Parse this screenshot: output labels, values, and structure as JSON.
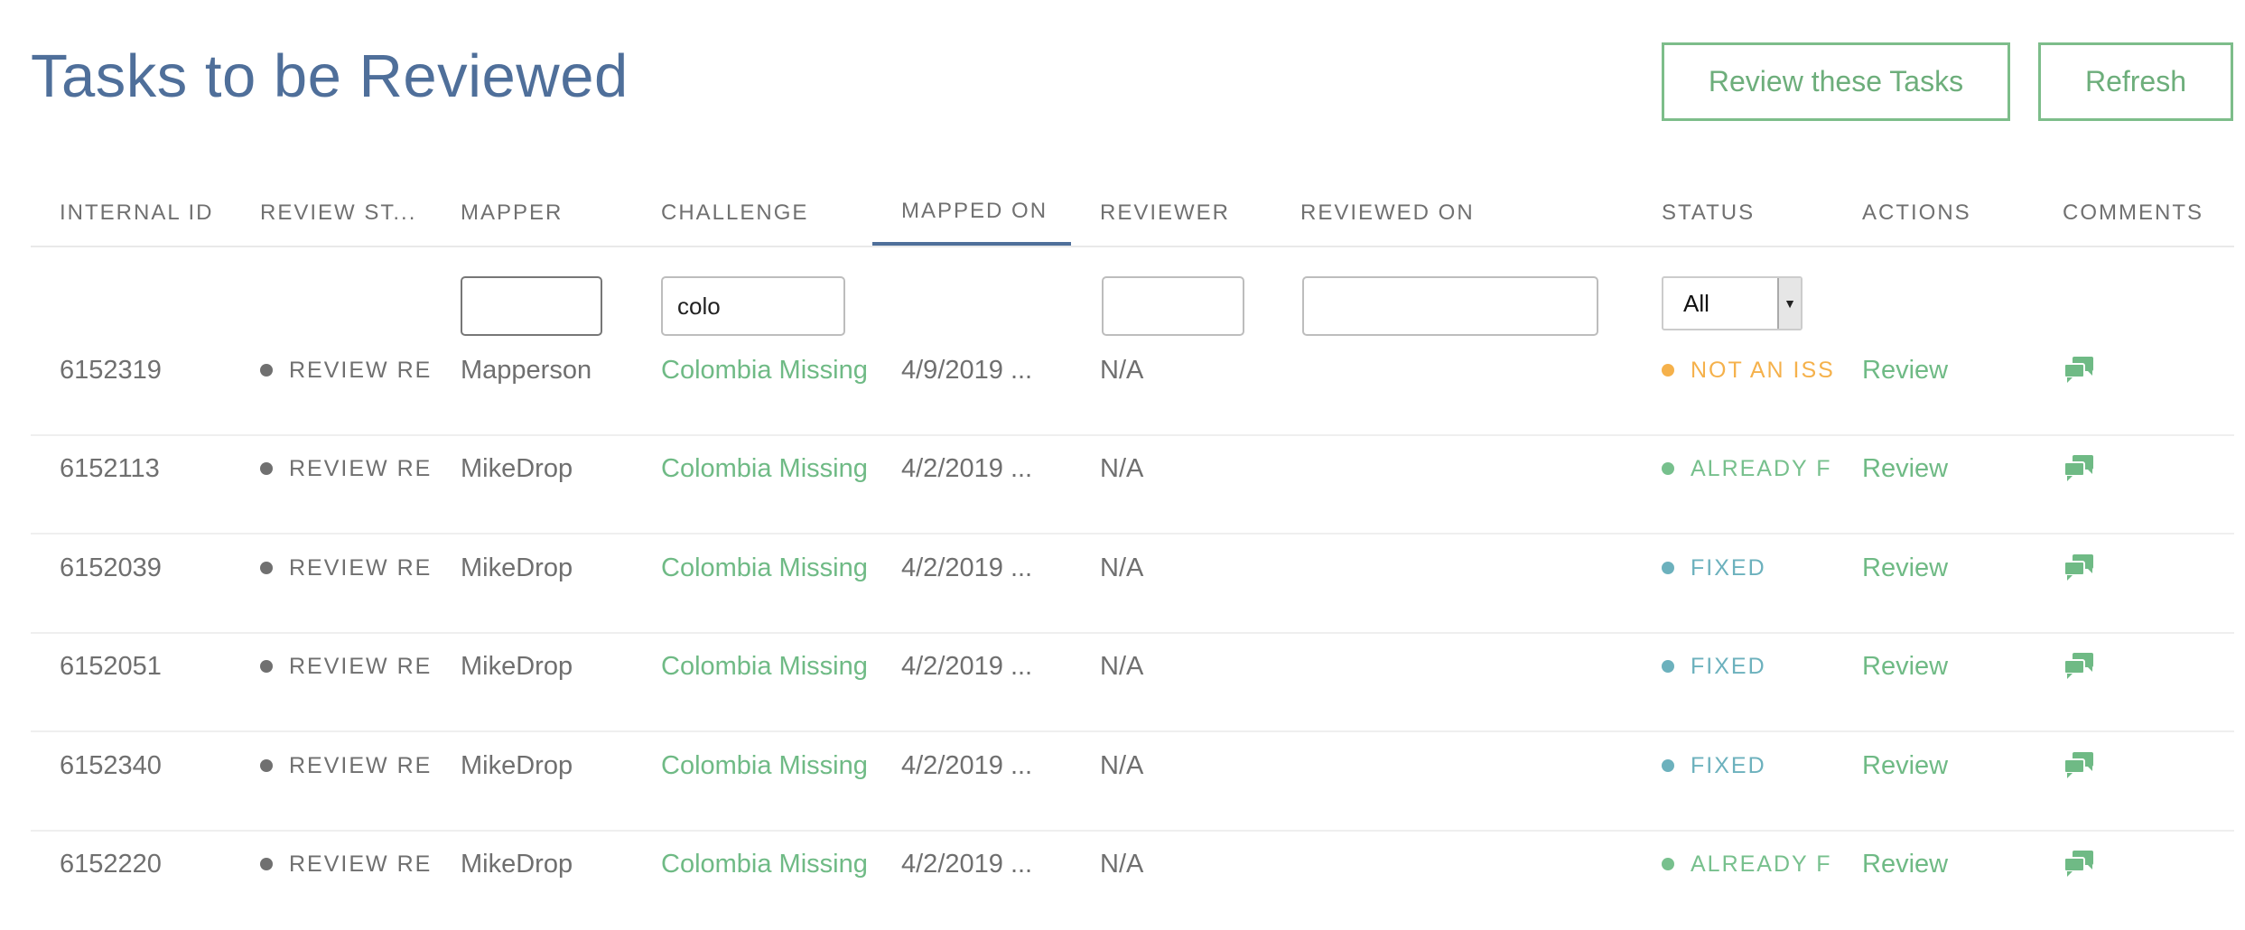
{
  "page": {
    "title": "Tasks to be Reviewed"
  },
  "toolbar": {
    "review_label": "Review these Tasks",
    "refresh_label": "Refresh"
  },
  "columns": [
    {
      "key": "internal_id",
      "label": "INTERNAL ID"
    },
    {
      "key": "review_status",
      "label": "REVIEW ST..."
    },
    {
      "key": "mapper",
      "label": "MAPPER"
    },
    {
      "key": "challenge",
      "label": "CHALLENGE"
    },
    {
      "key": "mapped_on",
      "label": "MAPPED ON",
      "sorted": true
    },
    {
      "key": "reviewer",
      "label": "REVIEWER"
    },
    {
      "key": "reviewed_on",
      "label": "REVIEWED ON"
    },
    {
      "key": "status",
      "label": "STATUS"
    },
    {
      "key": "actions",
      "label": "ACTIONS"
    },
    {
      "key": "comments",
      "label": "COMMENTS"
    }
  ],
  "filters": {
    "mapper": "",
    "challenge": "colo",
    "reviewer": "",
    "reviewed_on": "",
    "status_selected": "All"
  },
  "colors": {
    "title": "#4f6f9a",
    "accent_green": "#6fba85",
    "status_not_an_issue": "#f5b14b",
    "status_already_fixed": "#77c08d",
    "status_fixed": "#6cb1bd",
    "review_dot": "#707070"
  },
  "rows": [
    {
      "id": "6152319",
      "review_status": "REVIEW REQU",
      "mapper": "Mapperson",
      "challenge": "Colombia Missing I",
      "mapped_on": "4/9/2019 ...",
      "reviewer": "N/A",
      "reviewed_on": "",
      "status": "NOT AN ISSU",
      "status_kind": "not_an_issue",
      "action": "Review",
      "comment_icon": "comments-icon"
    },
    {
      "id": "6152113",
      "review_status": "REVIEW REQU",
      "mapper": "MikeDrop",
      "challenge": "Colombia Missing I",
      "mapped_on": "4/2/2019 ...",
      "reviewer": "N/A",
      "reviewed_on": "",
      "status": "ALREADY FIX",
      "status_kind": "already_fixed",
      "action": "Review",
      "comment_icon": "comments-icon"
    },
    {
      "id": "6152039",
      "review_status": "REVIEW REQU",
      "mapper": "MikeDrop",
      "challenge": "Colombia Missing I",
      "mapped_on": "4/2/2019 ...",
      "reviewer": "N/A",
      "reviewed_on": "",
      "status": "FIXED",
      "status_kind": "fixed",
      "action": "Review",
      "comment_icon": "comments-icon"
    },
    {
      "id": "6152051",
      "review_status": "REVIEW REQU",
      "mapper": "MikeDrop",
      "challenge": "Colombia Missing I",
      "mapped_on": "4/2/2019 ...",
      "reviewer": "N/A",
      "reviewed_on": "",
      "status": "FIXED",
      "status_kind": "fixed",
      "action": "Review",
      "comment_icon": "comments-icon"
    },
    {
      "id": "6152340",
      "review_status": "REVIEW REQU",
      "mapper": "MikeDrop",
      "challenge": "Colombia Missing I",
      "mapped_on": "4/2/2019 ...",
      "reviewer": "N/A",
      "reviewed_on": "",
      "status": "FIXED",
      "status_kind": "fixed",
      "action": "Review",
      "comment_icon": "comments-icon"
    },
    {
      "id": "6152220",
      "review_status": "REVIEW REQU",
      "mapper": "MikeDrop",
      "challenge": "Colombia Missing I",
      "mapped_on": "4/2/2019 ...",
      "reviewer": "N/A",
      "reviewed_on": "",
      "status": "ALREADY FIX",
      "status_kind": "already_fixed",
      "action": "Review",
      "comment_icon": "comments-icon"
    }
  ]
}
